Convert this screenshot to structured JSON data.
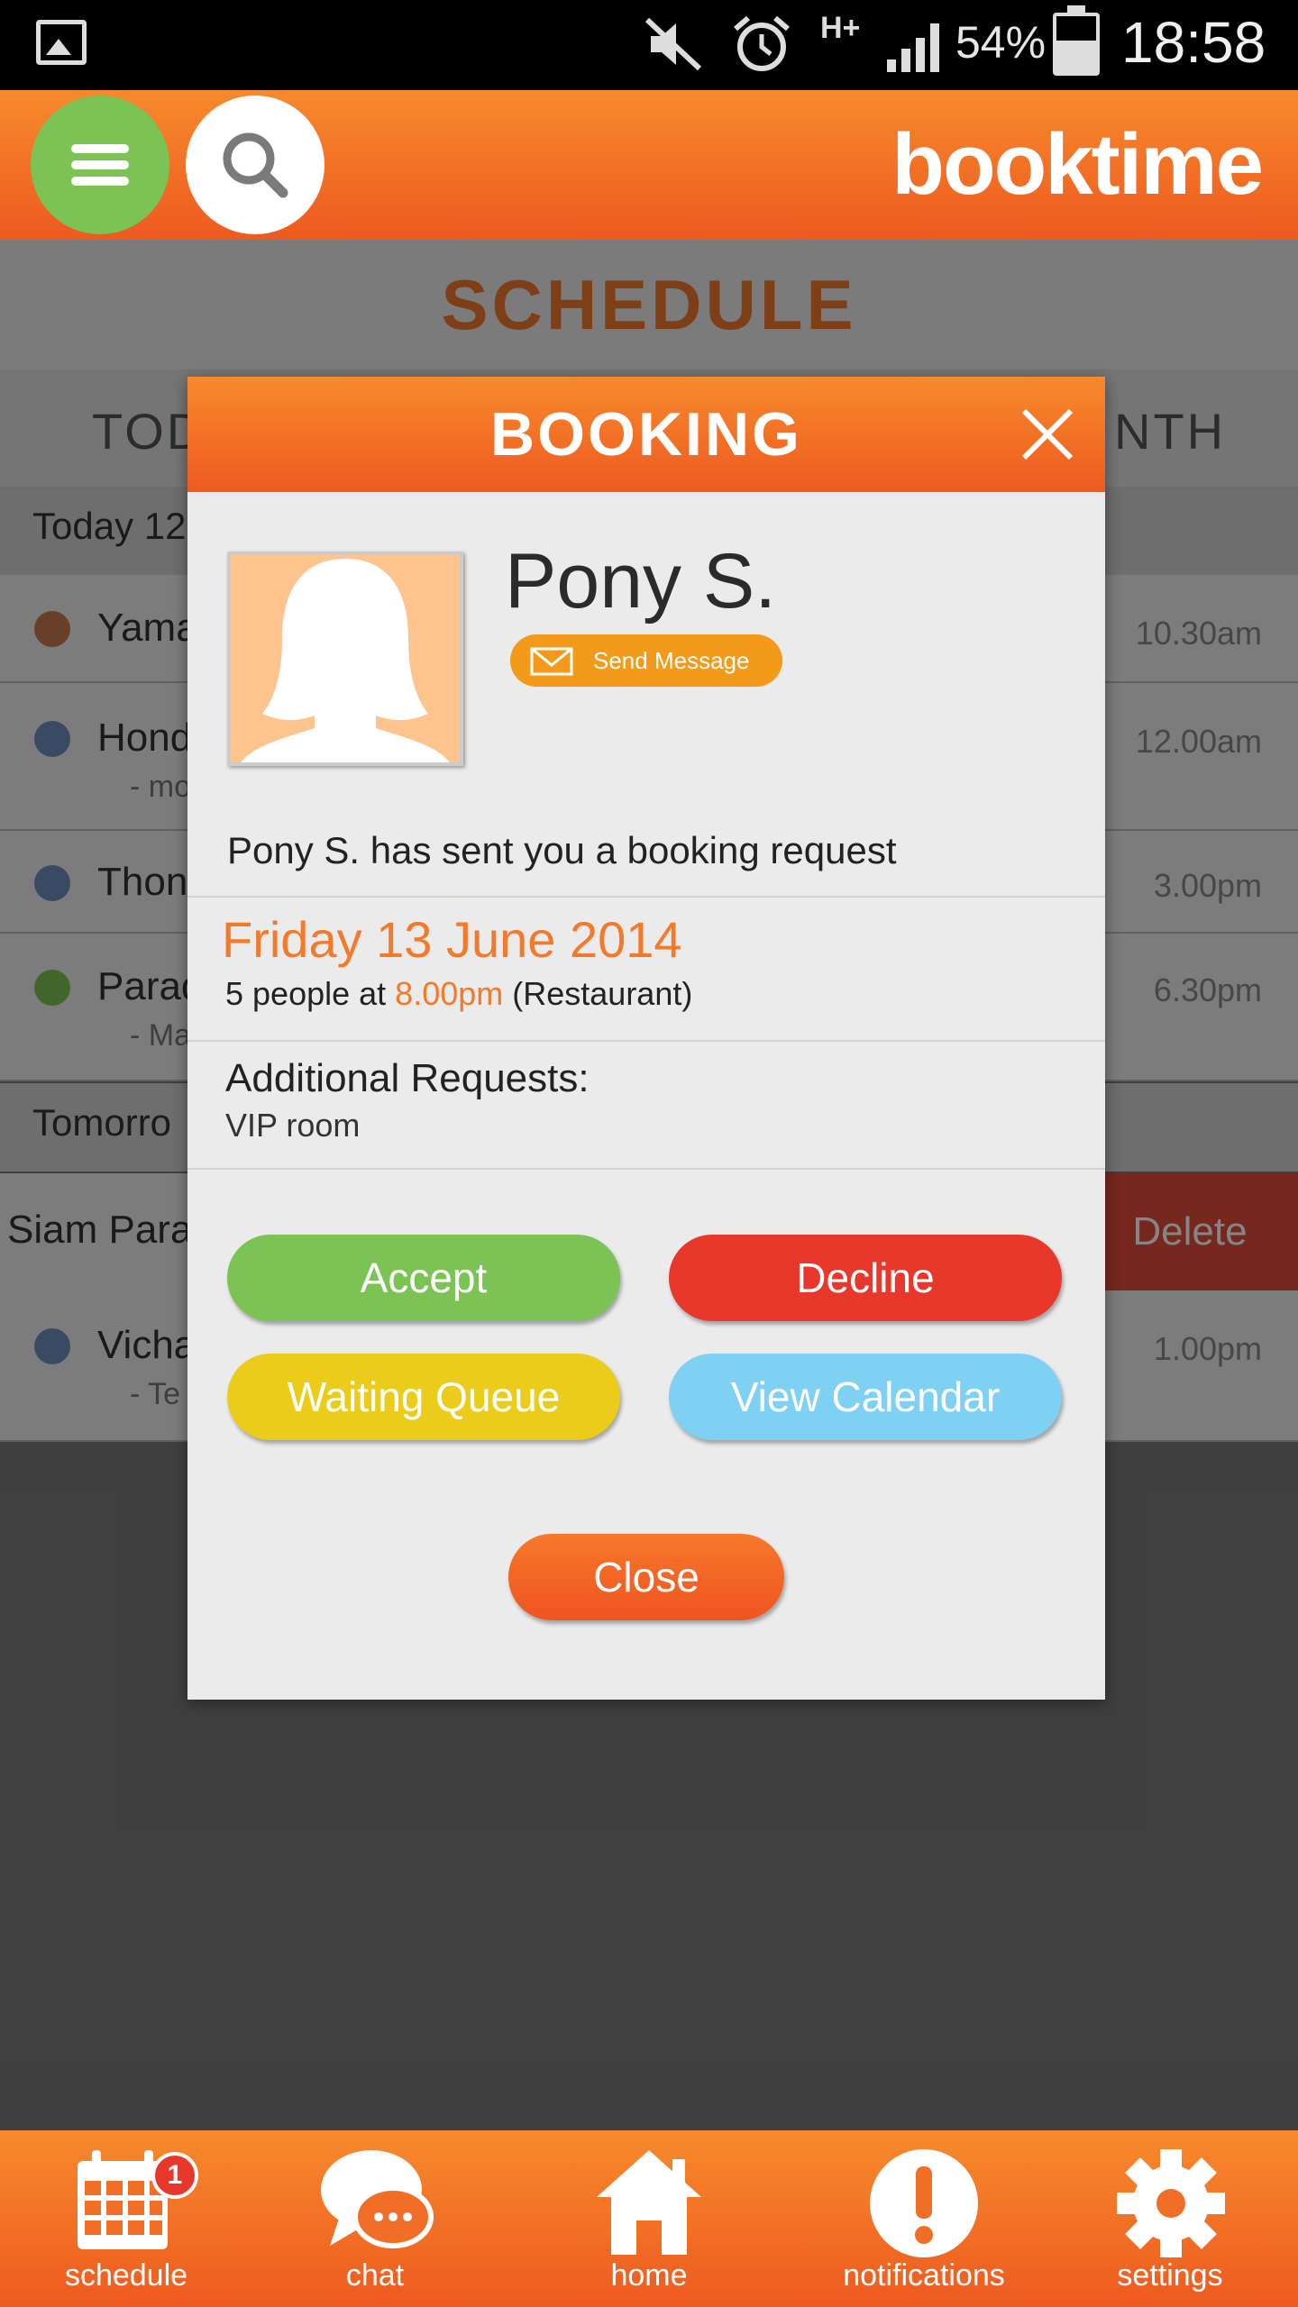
{
  "status_bar": {
    "battery_percent": "54%",
    "clock": "18:58",
    "network": "H+"
  },
  "header": {
    "brand": "booktime"
  },
  "background": {
    "title": "SCHEDULE",
    "tabs": [
      "TOD",
      "NTH"
    ],
    "sections": [
      {
        "label": "Today 12"
      },
      {
        "label": "Tomorro"
      }
    ],
    "rows": [
      {
        "name": "Yama",
        "sub": "",
        "time": "10.30am",
        "dot_color": "#c87a4f"
      },
      {
        "name": "Hond",
        "sub": "- mo",
        "time": "12.00am",
        "dot_color": "#6e8fbf"
      },
      {
        "name": "Thon",
        "sub": "",
        "time": "3.00pm",
        "dot_color": "#6e8fbf"
      },
      {
        "name": "Parad",
        "sub": "- Ma",
        "time": "6.30pm",
        "dot_color": "#7cc355"
      },
      {
        "name": "Vicha",
        "sub": "- Te",
        "time": "1.00pm",
        "dot_color": "#6e8fbf"
      }
    ],
    "swipe_row": {
      "name": "Siam Para",
      "action": "Delete"
    }
  },
  "dialog": {
    "title": "BOOKING",
    "person_name": "Pony S.",
    "send_message": "Send Message",
    "request_text": "Pony S. has sent you a booking request",
    "date": "Friday 13 June 2014",
    "details_prefix": "5 people at",
    "details_time": "8.00pm",
    "details_suffix": "(Restaurant)",
    "additional_title": "Additional Requests:",
    "additional_value": "VIP room",
    "buttons": {
      "accept": "Accept",
      "decline": "Decline",
      "waiting_queue": "Waiting Queue",
      "view_calendar": "View Calendar",
      "close": "Close"
    }
  },
  "bottom_nav": {
    "items": [
      {
        "label": "schedule",
        "icon": "calendar-icon",
        "badge": "1"
      },
      {
        "label": "chat",
        "icon": "chat-bubble-icon"
      },
      {
        "label": "home",
        "icon": "home-icon"
      },
      {
        "label": "notifications",
        "icon": "exclamation-icon"
      },
      {
        "label": "settings",
        "icon": "gear-icon"
      }
    ]
  },
  "colors": {
    "brand_orange": "#ef6a24",
    "accept": "#7cc355",
    "decline": "#e8382c",
    "waiting": "#eccc1a",
    "calendar": "#7fd1f3"
  }
}
